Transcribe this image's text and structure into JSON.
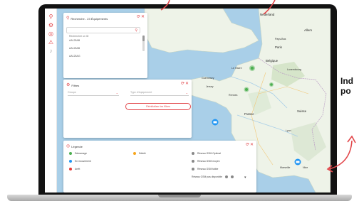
{
  "search_panel": {
    "title": "Recherche - 23 Équipements",
    "search_placeholder": "Rechercher un ID",
    "items": [
      "AA125AB",
      "AA125AB",
      "AA125AG"
    ]
  },
  "filters_panel": {
    "title": "Filtres",
    "group_placeholder": "Groupe",
    "equipment_type_placeholder": "Type d'équipement",
    "reset_label": "Réinitialiser les filtres"
  },
  "legend_panel": {
    "title": "Légende",
    "statuses": [
      {
        "label": "Démarrage",
        "color": "#4caf50"
      },
      {
        "label": "En mouvement",
        "color": "#2196f3"
      },
      {
        "label": "Arrêt",
        "color": "#e53935"
      },
      {
        "label": "Dételé",
        "color": "#f7a51c"
      }
    ],
    "gps_levels": [
      "Réseau GSM Optimal",
      "Réseau GSM moyen",
      "Réseau GSM faible",
      "Réseau GSM pas disponible"
    ]
  },
  "map_labels": {
    "nederland": "Nederland",
    "paris": "Paris",
    "belgique": "Belgique",
    "luxembourg": "Luxembourg",
    "france": "France",
    "suisse": "Suisse",
    "guernsey": "Guernesey",
    "jersey": "Jersey",
    "allemagne": "Allem",
    "pays_bas": "Pays-Bas",
    "nice": "Nice",
    "marseille": "Marseille",
    "rennes": "Rennes",
    "lyon": "Lyon",
    "le_havre": "Le Havre"
  },
  "side_text": {
    "line1": "Ind",
    "line2": "po"
  },
  "colors": {
    "accent": "#e2474b",
    "water": "#a9cfe8",
    "land": "#eef3e8",
    "status_green": "#4caf50",
    "status_blue": "#2196f3",
    "status_red": "#e53935",
    "status_orange": "#f7a51c"
  },
  "icons": {
    "rail": [
      "search-icon",
      "filter-icon",
      "target-icon",
      "warning-icon",
      "bell-icon"
    ],
    "panel_actions": [
      "refresh-icon",
      "close-icon"
    ]
  }
}
